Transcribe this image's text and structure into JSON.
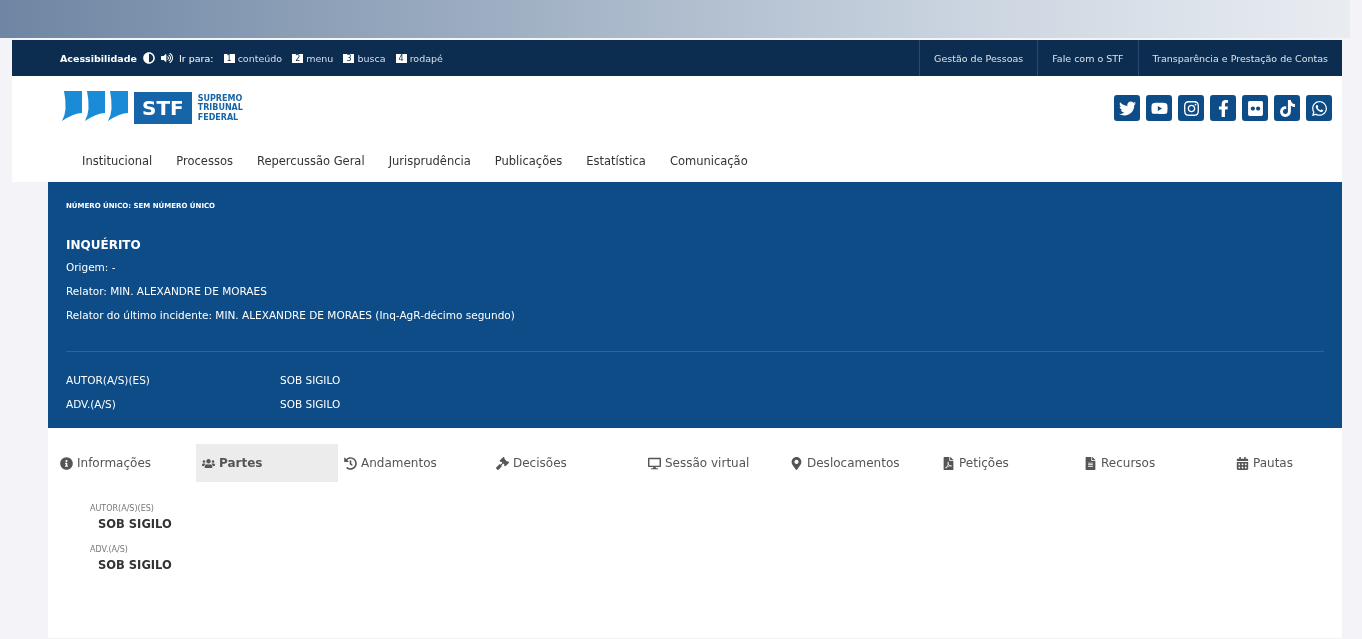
{
  "accessibility_bar": {
    "label": "Acessibilidade",
    "goto_label": "Ir para:",
    "shortcuts": [
      {
        "key": "1",
        "label": "conteúdo"
      },
      {
        "key": "2",
        "label": "menu"
      },
      {
        "key": "3",
        "label": "busca"
      },
      {
        "key": "4",
        "label": "rodapé"
      }
    ],
    "links": [
      "Gestão de Pessoas",
      "Fale com o STF",
      "Transparência e Prestação de Contas"
    ]
  },
  "logo": {
    "mark": "STF",
    "name_lines": [
      "SUPREMO",
      "TRIBUNAL",
      "FEDERAL"
    ]
  },
  "nav": [
    "Institucional",
    "Processos",
    "Repercussão Geral",
    "Jurisprudência",
    "Publicações",
    "Estatística",
    "Comunicação"
  ],
  "process": {
    "number_line": "NÚMERO ÚNICO: SEM NÚMERO ÚNICO",
    "class": "INQUÉRITO",
    "details": [
      "Origem: -",
      "Relator: MIN. ALEXANDRE DE MORAES",
      "Relator do último incidente: MIN. ALEXANDRE DE MORAES (Inq-AgR-décimo segundo)"
    ],
    "parties": [
      {
        "role": "AUTOR(A/S)(ES)",
        "name": "SOB SIGILO"
      },
      {
        "role": "ADV.(A/S)",
        "name": "SOB SIGILO"
      }
    ]
  },
  "tabs": [
    {
      "label": "Informações",
      "selected": false
    },
    {
      "label": "Partes",
      "selected": true
    },
    {
      "label": "Andamentos",
      "selected": false
    },
    {
      "label": "Decisões",
      "selected": false
    },
    {
      "label": "Sessão virtual",
      "selected": false
    },
    {
      "label": "Deslocamentos",
      "selected": false
    },
    {
      "label": "Petições",
      "selected": false
    },
    {
      "label": "Recursos",
      "selected": false
    },
    {
      "label": "Pautas",
      "selected": false
    }
  ],
  "party_list": [
    {
      "role": "AUTOR(A/S)(ES)",
      "name": "SOB SIGILO"
    },
    {
      "role": "ADV.(A/S)",
      "name": "SOB SIGILO"
    }
  ]
}
